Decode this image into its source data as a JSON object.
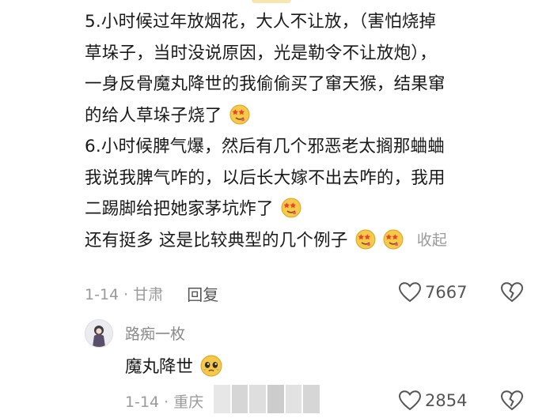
{
  "comment": {
    "lines": [
      "5.小时候过年放烟花，大人不让放，（害怕烧掉",
      "草垛子，当时没说原因，光是勒令不让放炮），",
      "一身反骨魔丸降世的我偷偷买了窜天猴，结果窜",
      "的给人草垛子烧了",
      "6.小时候脾气爆，然后有几个邪恶老太搁那蛐蛐",
      "我说我脾气咋的，以后长大嫁不出去咋的，我用",
      "二踢脚给把她家茅坑炸了",
      "还有挺多 这是比较典型的几个例子"
    ],
    "collapse_label": "收起",
    "date_location": "1-14 · 甘肃",
    "reply_label": "回复",
    "like_count": "7667"
  },
  "reply": {
    "username": "路痴一枚",
    "text": "魔丸降世",
    "date_location": "1-14 · 重庆",
    "reply_label": "回复",
    "like_count": "2854"
  },
  "emoji_names": [
    "drooling-star-eyes-emoji",
    "teary-pleading-emoji"
  ],
  "colors": {
    "text": "#1a1a1a",
    "meta": "#9a9a9a",
    "emoji_yellow": "#f7c94b"
  }
}
